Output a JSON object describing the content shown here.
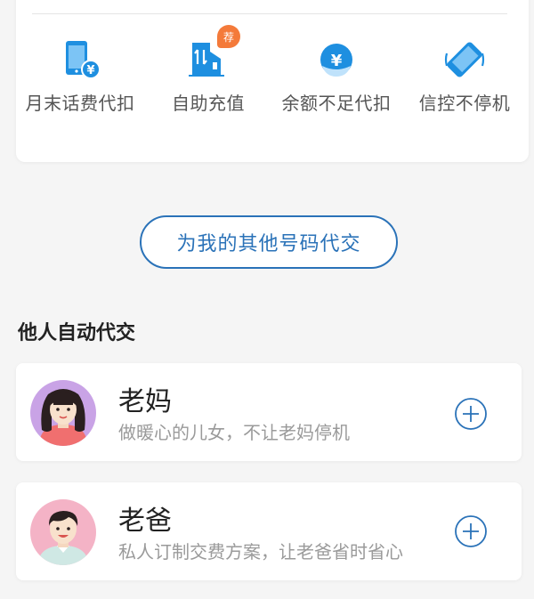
{
  "services": [
    {
      "label": "月末话费代扣",
      "icon": "phone-bill-icon"
    },
    {
      "label": "自助充值",
      "icon": "self-recharge-icon",
      "badge": "荐"
    },
    {
      "label": "余额不足代扣",
      "icon": "yuan-coin-icon"
    },
    {
      "label": "信控不停机",
      "icon": "credit-phone-icon"
    }
  ],
  "other_number_button": "为我的其他号码代交",
  "section_title": "他人自动代交",
  "people": [
    {
      "name": "老妈",
      "desc": "做暖心的儿女，不让老妈停机"
    },
    {
      "name": "老爸",
      "desc": "私人订制交费方案，让老爸省时省心"
    }
  ],
  "colors": {
    "accent": "#2a72b8",
    "badge": "#f47a3a",
    "icon_blue": "#1e8fe0"
  }
}
